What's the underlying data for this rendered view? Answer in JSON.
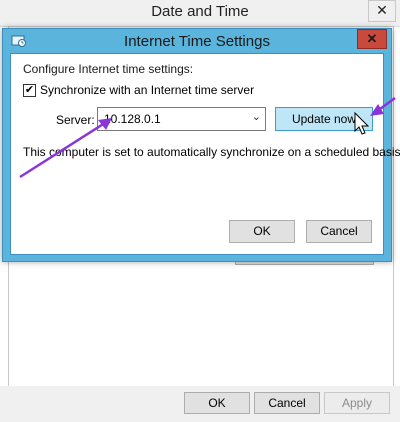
{
  "parent_window": {
    "title": "Date and Time",
    "close_glyph": "✕",
    "buttons": {
      "ok": "OK",
      "cancel": "Cancel",
      "apply": "Apply"
    }
  },
  "dialog": {
    "title": "Internet Time Settings",
    "close_glyph": "✕",
    "heading": "Configure Internet time settings:",
    "sync_checkbox": {
      "label": "Synchronize with an Internet time server",
      "checked": true,
      "glyph": "✔"
    },
    "server_label": "Server:",
    "server_value": "10.128.0.1",
    "combo_arrow": "⌄",
    "update_button": "Update now",
    "info_text": "This computer is set to automatically synchronize on a scheduled basis.",
    "buttons": {
      "ok": "OK",
      "cancel": "Cancel"
    }
  },
  "colors": {
    "dialog_frame": "#5ab4dc",
    "annotation_arrow": "#8a35d8",
    "update_button_bg": "#bfe6f7"
  },
  "icons": [
    "app-icon",
    "close-icon",
    "chevron-down-icon",
    "checkmark-icon",
    "mouse-cursor-icon"
  ]
}
